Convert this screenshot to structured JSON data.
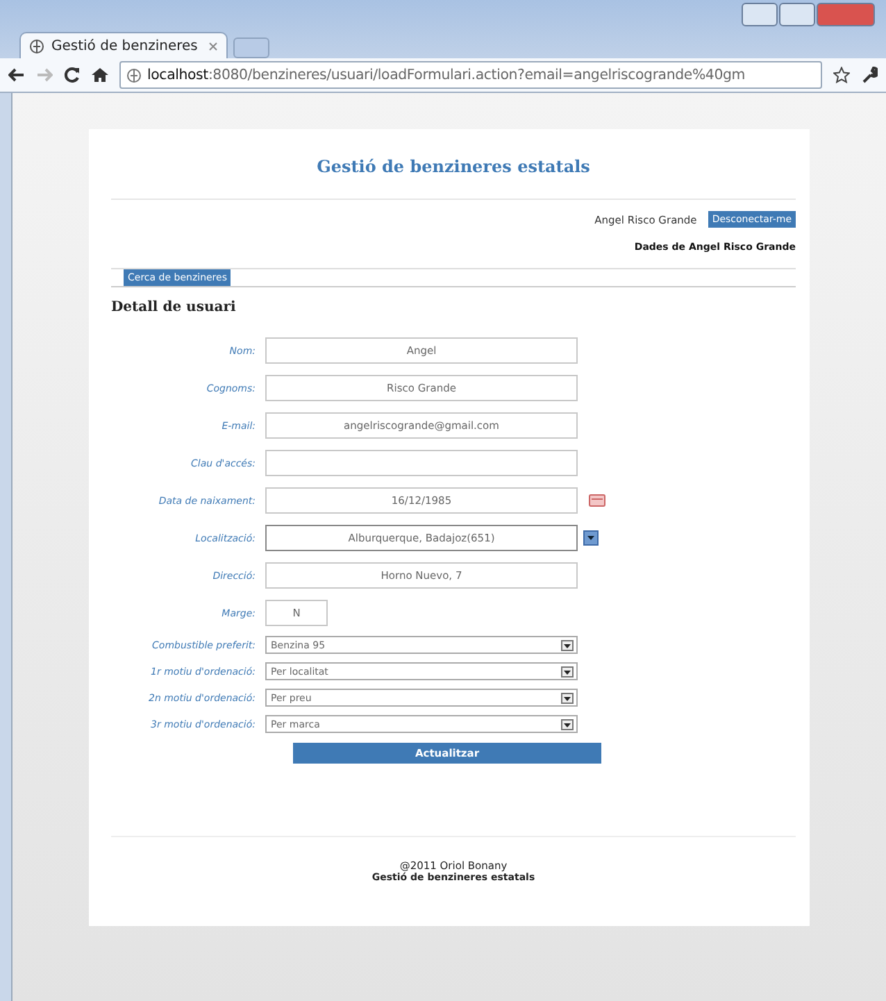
{
  "browser": {
    "tab_title": "Gestió de benzineres",
    "address_host": "localhost",
    "address_rest": ":8080/benzineres/usuari/loadFormulari.action?email=angelriscogrande%40gm"
  },
  "page": {
    "title": "Gestió de benzineres estatals",
    "user_name": "Angel Risco Grande",
    "logout_button": "Desconectar-me",
    "user_data_heading": "Dades de Angel Risco Grande",
    "menu_tabs": [
      {
        "label": "Cerca de benzineres",
        "selected": true
      }
    ],
    "section_title": "Detall de usuari",
    "fields": [
      {
        "label": "Nom:",
        "kind": "text",
        "value": "Angel"
      },
      {
        "label": "Cognoms:",
        "kind": "text",
        "value": "Risco Grande"
      },
      {
        "label": "E-mail:",
        "kind": "text",
        "value": "angelriscogrande@gmail.com"
      },
      {
        "label": "Clau d'accés:",
        "kind": "text"
      },
      {
        "label": "Data de naixament:",
        "kind": "date",
        "value": "16/12/1985"
      },
      {
        "label": "Localització:",
        "kind": "combo",
        "value": "Alburquerque, Badajoz(651)"
      },
      {
        "label": "Direcció:",
        "kind": "text",
        "value": "Horno Nuevo, 7"
      },
      {
        "label": "Marge:",
        "kind": "short",
        "value": "N"
      },
      {
        "label": "Combustible preferit:",
        "kind": "select",
        "value": "Benzina 95"
      },
      {
        "label": "1r motiu d'ordenació:",
        "kind": "select",
        "value": "Per localitat"
      },
      {
        "label": "2n motiu d'ordenació:",
        "kind": "select",
        "value": "Per preu"
      },
      {
        "label": "3r motiu d'ordenació:",
        "kind": "select",
        "value": "Per marca"
      }
    ],
    "submit_button": "Actualitzar",
    "footer_copyright": "@2011 Oriol Bonany",
    "footer_title": "Gestió de benzineres estatals"
  }
}
